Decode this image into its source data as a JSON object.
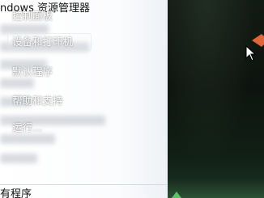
{
  "left_pane": {
    "top_program": "ndows 资源管理器",
    "bottom_program": "有程序"
  },
  "right_pane": {
    "items": [
      {
        "label": "控制面板"
      },
      {
        "label": "设备和打印机"
      },
      {
        "label": "默认程序"
      },
      {
        "label": "帮助和支持"
      },
      {
        "label": "运行..."
      }
    ]
  },
  "colors": {
    "accent_arrow": "#e0663a",
    "right_pane_dark": "#0d140f",
    "glow_green": "#5fbf6a"
  },
  "icons": {
    "pointer": "mouse-pointer-icon",
    "arrow": "orange-arrow-icon"
  }
}
